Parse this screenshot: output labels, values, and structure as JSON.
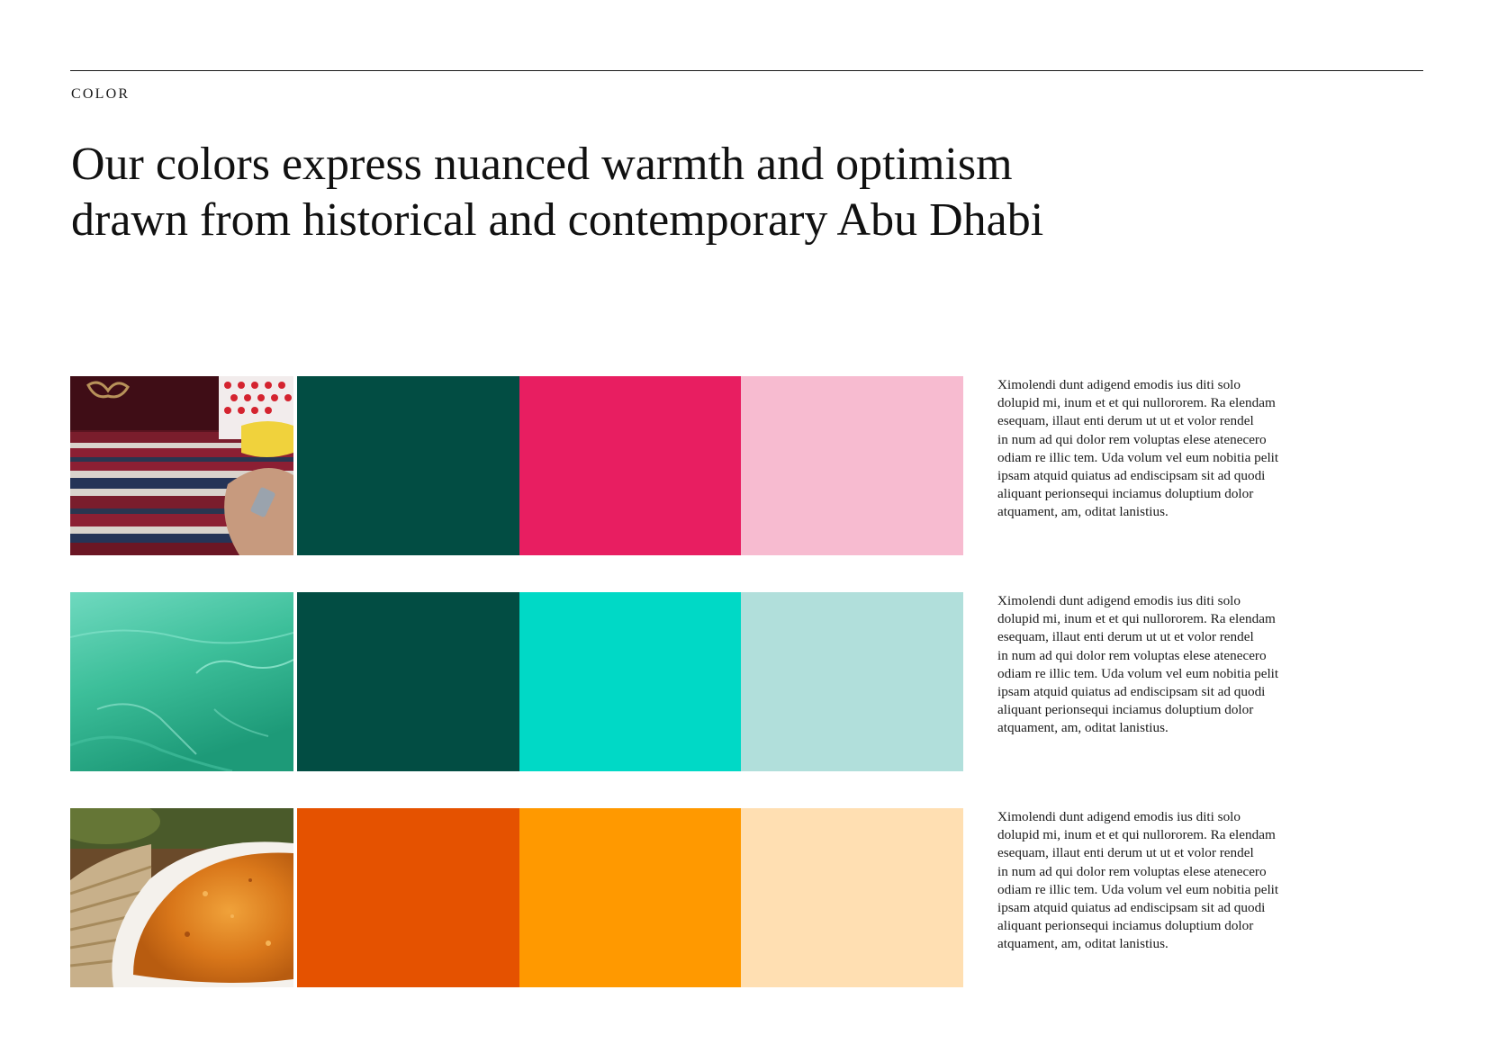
{
  "page": {
    "section_label": "COLOR",
    "headline_lines": [
      "Our colors express nuanced warmth and optimism",
      "drawn from historical and contemporary Abu Dhabi"
    ]
  },
  "palettes": [
    {
      "photo_icon": "textile-pattern-image",
      "swatches": [
        "#024d43",
        "#e81e61",
        "#f7bbd0"
      ],
      "description_lines": [
        "Ximolendi dunt adigend emodis ius diti solo",
        "dolupid mi, inum et et qui nullororem. Ra elendam",
        "esequam, illaut enti derum ut ut et volor rendel",
        "in num ad qui dolor rem voluptas elese atenecero",
        "odiam re illic tem. Uda volum vel eum nobitia pelit",
        "ipsam atquid quiatus ad endiscipsam sit ad quodi",
        "aliquant perionsequi inciamus doluptium dolor",
        "atquament, am, oditat lanistius."
      ]
    },
    {
      "photo_icon": "sea-water-image",
      "swatches": [
        "#024d43",
        "#00d9c6",
        "#b1dfdb"
      ],
      "description_lines": [
        "Ximolendi dunt adigend emodis ius diti solo",
        "dolupid mi, inum et et qui nullororem. Ra elendam",
        "esequam, illaut enti derum ut ut et volor rendel",
        "in num ad qui dolor rem voluptas elese atenecero",
        "odiam re illic tem. Uda volum vel eum nobitia pelit",
        "ipsam atquid quiatus ad endiscipsam sit ad quodi",
        "aliquant perionsequi inciamus doluptium dolor",
        "atquament, am, oditat lanistius."
      ]
    },
    {
      "photo_icon": "spice-bowl-image",
      "swatches": [
        "#e55200",
        "#ff9900",
        "#ffdfb2"
      ],
      "description_lines": [
        "Ximolendi dunt adigend emodis ius diti solo",
        "dolupid mi, inum et et qui nullororem. Ra elendam",
        "esequam, illaut enti derum ut ut et volor rendel",
        "in num ad qui dolor rem voluptas elese atenecero",
        "odiam re illic tem. Uda volum vel eum nobitia pelit",
        "ipsam atquid quiatus ad endiscipsam sit ad quodi",
        "aliquant perionsequi inciamus doluptium dolor",
        "atquament, am, oditat lanistius."
      ]
    }
  ]
}
